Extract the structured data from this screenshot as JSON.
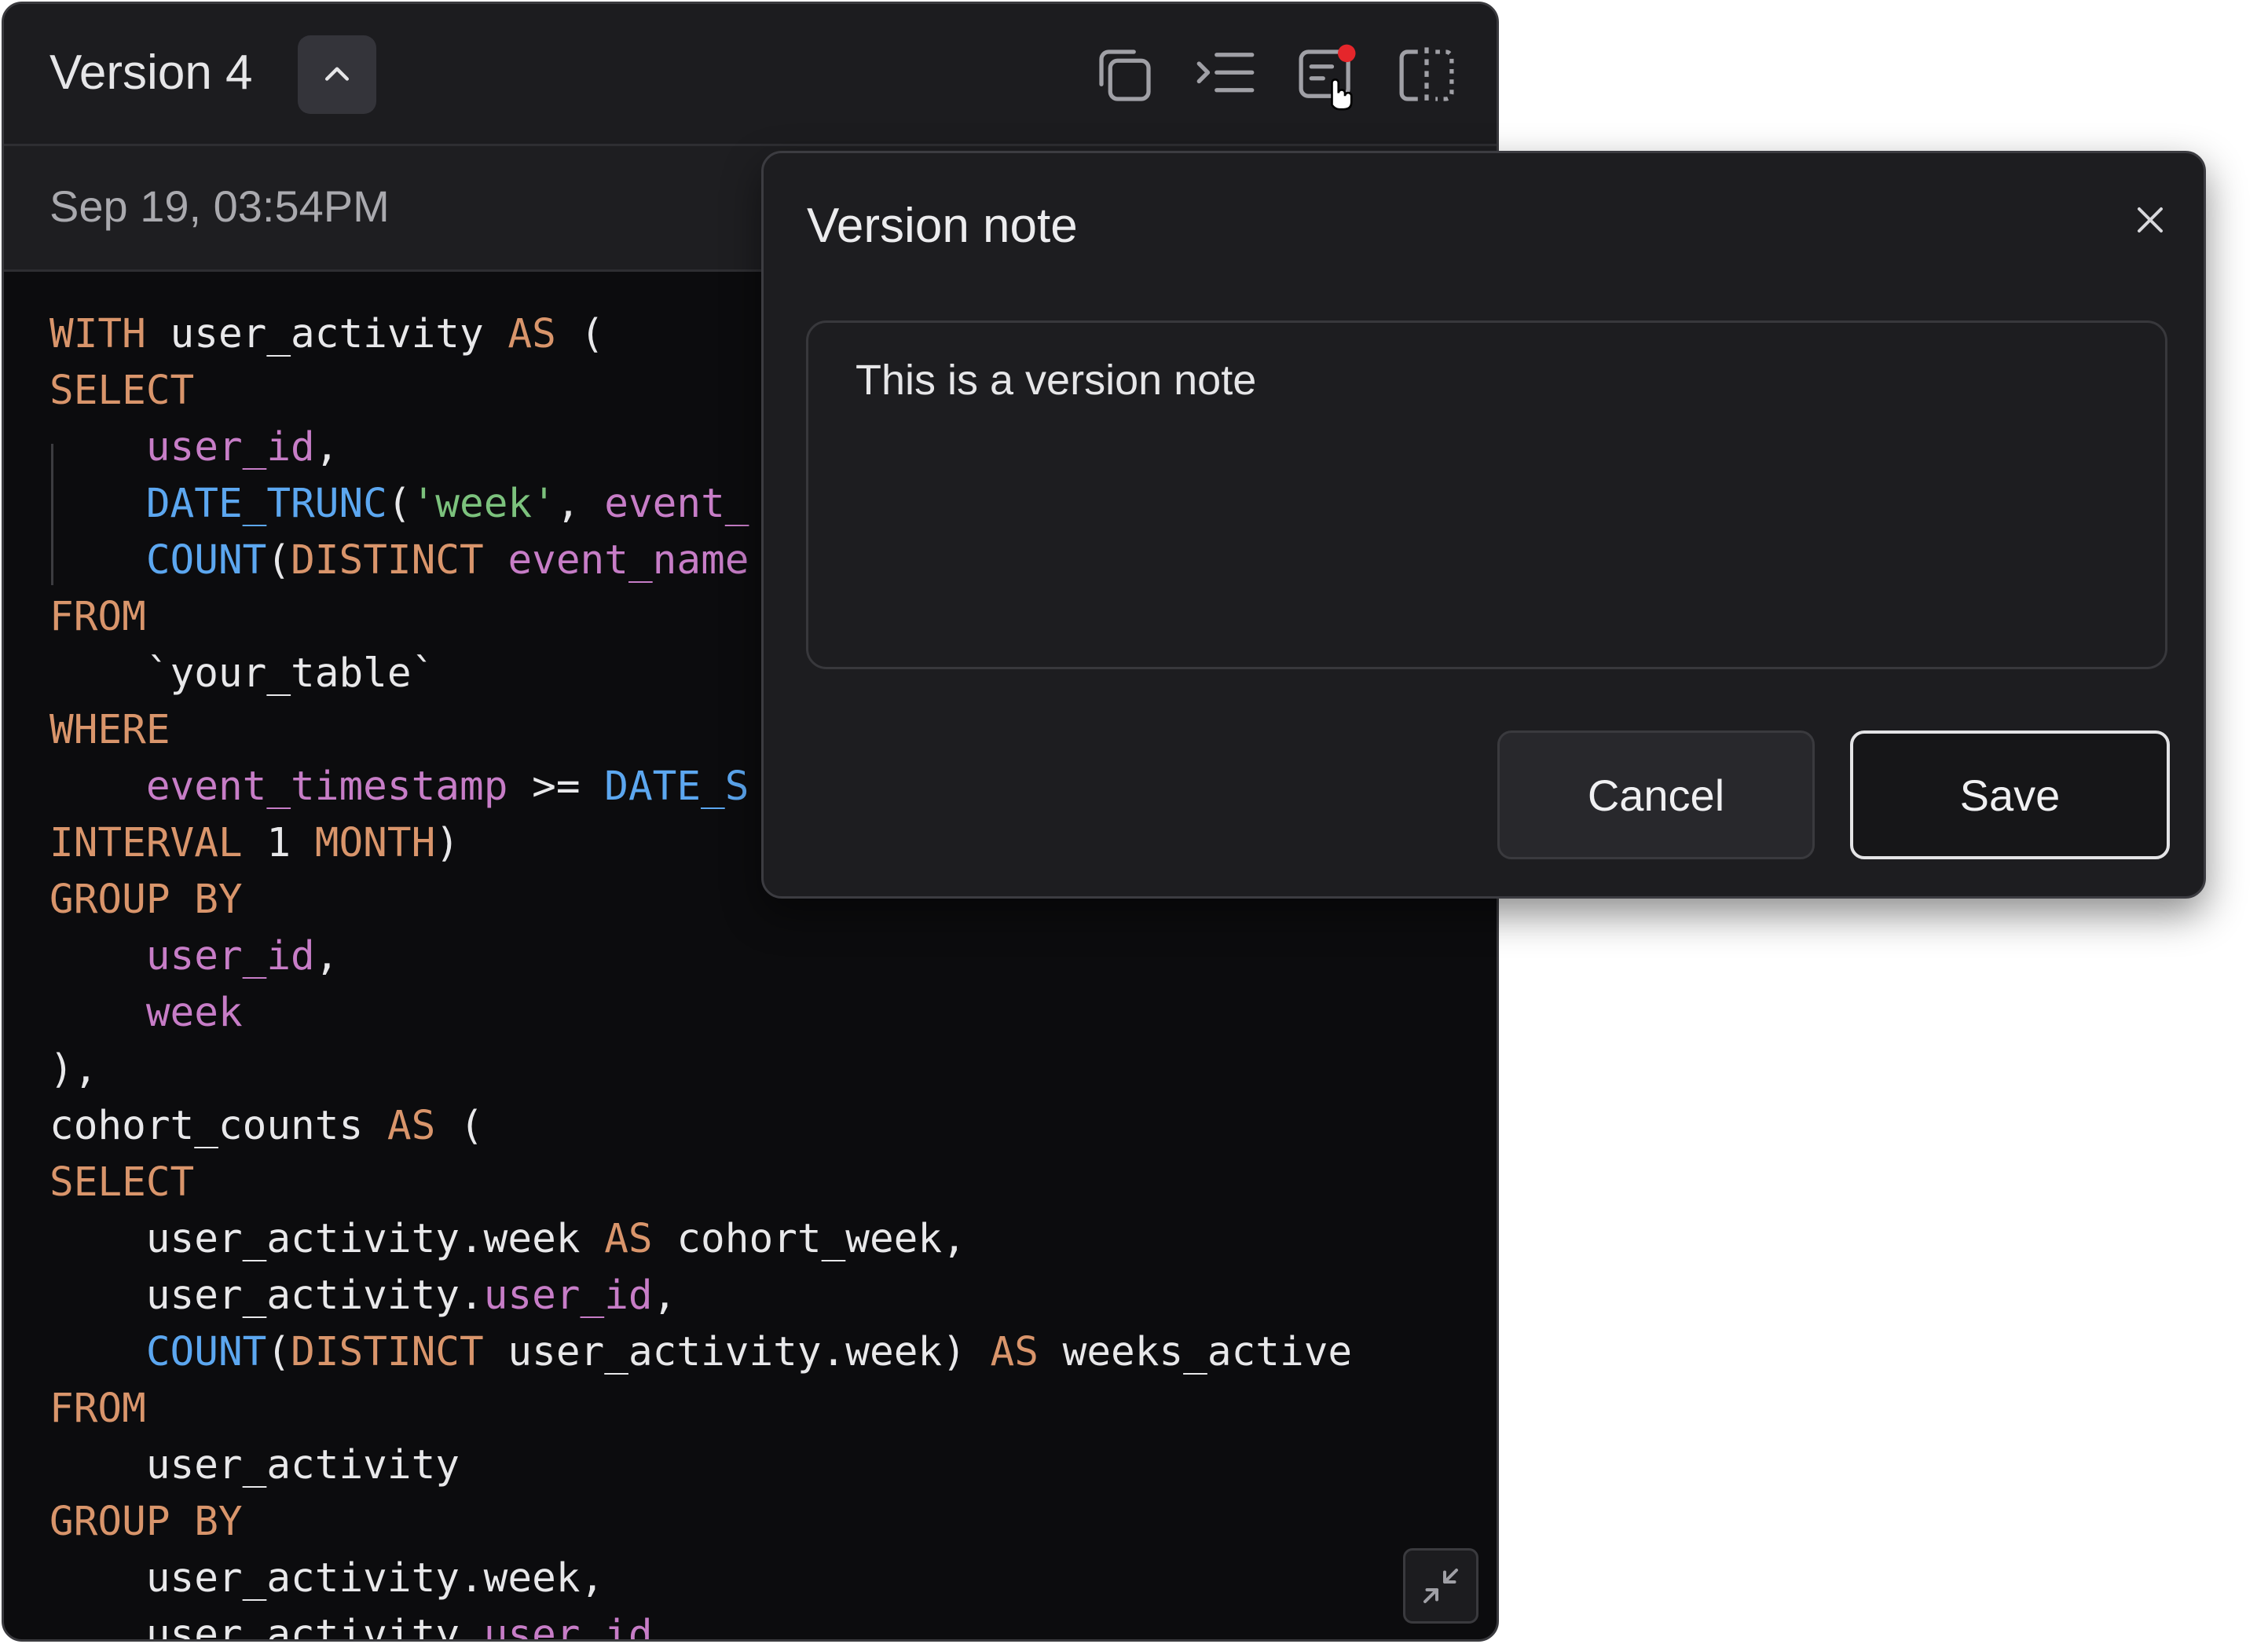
{
  "header": {
    "version_label": "Version 4",
    "collapse_icon": "chevron-up-icon",
    "toolbar_icons": [
      "copy-icon",
      "indent-icon",
      "version-note-icon",
      "split-view-icon"
    ],
    "notification_color": "#e5262b"
  },
  "subheader": {
    "timestamp": "Sep 19, 03:54PM"
  },
  "code_lines": [
    [
      {
        "t": "WITH",
        "c": "kw"
      },
      {
        "t": " user_activity ",
        "c": ""
      },
      {
        "t": "AS",
        "c": "kw"
      },
      {
        "t": " (",
        "c": ""
      }
    ],
    [
      {
        "t": "SELECT",
        "c": "kw"
      }
    ],
    [
      {
        "t": "    ",
        "c": ""
      },
      {
        "t": "user_id",
        "c": "id"
      },
      {
        "t": ",",
        "c": ""
      }
    ],
    [
      {
        "t": "    ",
        "c": ""
      },
      {
        "t": "DATE_TRUNC",
        "c": "fn"
      },
      {
        "t": "(",
        "c": ""
      },
      {
        "t": "'week'",
        "c": "str"
      },
      {
        "t": ", ",
        "c": ""
      },
      {
        "t": "event_",
        "c": "id"
      }
    ],
    [
      {
        "t": "    ",
        "c": ""
      },
      {
        "t": "COUNT",
        "c": "fn"
      },
      {
        "t": "(",
        "c": ""
      },
      {
        "t": "DISTINCT",
        "c": "kw"
      },
      {
        "t": " ",
        "c": ""
      },
      {
        "t": "event_name",
        "c": "id"
      }
    ],
    [
      {
        "t": "FROM",
        "c": "kw"
      }
    ],
    [
      {
        "t": "    `your_table`",
        "c": ""
      }
    ],
    [
      {
        "t": "WHERE",
        "c": "kw"
      }
    ],
    [
      {
        "t": "    ",
        "c": ""
      },
      {
        "t": "event_timestamp",
        "c": "id"
      },
      {
        "t": " >= ",
        "c": ""
      },
      {
        "t": "DATE_S",
        "c": "fn"
      }
    ],
    [
      {
        "t": "INTERVAL",
        "c": "kw"
      },
      {
        "t": " 1 ",
        "c": ""
      },
      {
        "t": "MONTH",
        "c": "kw"
      },
      {
        "t": ")",
        "c": ""
      }
    ],
    [
      {
        "t": "GROUP BY",
        "c": "kw"
      }
    ],
    [
      {
        "t": "    ",
        "c": ""
      },
      {
        "t": "user_id",
        "c": "id"
      },
      {
        "t": ",",
        "c": ""
      }
    ],
    [
      {
        "t": "    ",
        "c": ""
      },
      {
        "t": "week",
        "c": "id"
      }
    ],
    [
      {
        "t": "),",
        "c": ""
      }
    ],
    [
      {
        "t": "cohort_counts ",
        "c": ""
      },
      {
        "t": "AS",
        "c": "kw"
      },
      {
        "t": " (",
        "c": ""
      }
    ],
    [
      {
        "t": "SELECT",
        "c": "kw"
      }
    ],
    [
      {
        "t": "    user_activity.week ",
        "c": ""
      },
      {
        "t": "AS",
        "c": "kw"
      },
      {
        "t": " cohort_week,",
        "c": ""
      }
    ],
    [
      {
        "t": "    user_activity.",
        "c": ""
      },
      {
        "t": "user_id",
        "c": "id"
      },
      {
        "t": ",",
        "c": ""
      }
    ],
    [
      {
        "t": "    ",
        "c": ""
      },
      {
        "t": "COUNT",
        "c": "fn"
      },
      {
        "t": "(",
        "c": ""
      },
      {
        "t": "DISTINCT",
        "c": "kw"
      },
      {
        "t": " user_activity.week) ",
        "c": ""
      },
      {
        "t": "AS",
        "c": "kw"
      },
      {
        "t": " weeks_active",
        "c": ""
      }
    ],
    [
      {
        "t": "FROM",
        "c": "kw"
      }
    ],
    [
      {
        "t": "    user_activity",
        "c": ""
      }
    ],
    [
      {
        "t": "GROUP BY",
        "c": "kw"
      }
    ],
    [
      {
        "t": "    user_activity.week,",
        "c": ""
      }
    ],
    [
      {
        "t": "    user_activity.",
        "c": ""
      },
      {
        "t": "user_id",
        "c": "id"
      }
    ]
  ],
  "dialog": {
    "title": "Version note",
    "note_text": "This is a version note",
    "cancel_label": "Cancel",
    "save_label": "Save",
    "close_icon": "close-icon"
  },
  "minimize_icon": "minimize-icon"
}
